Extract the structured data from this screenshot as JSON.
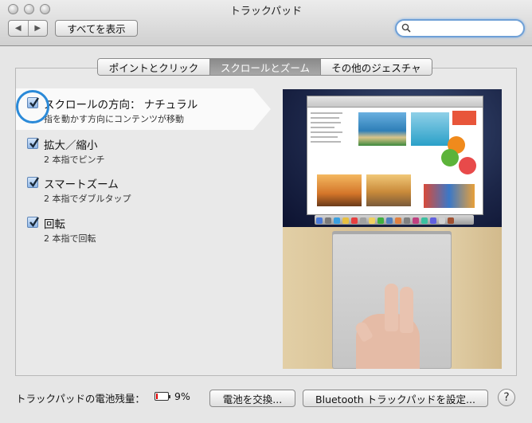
{
  "window": {
    "title": "トラックパッド"
  },
  "toolbar": {
    "show_all_label": "すべてを表示",
    "search_placeholder": ""
  },
  "tabs": [
    {
      "label": "ポイントとクリック",
      "selected": false
    },
    {
      "label": "スクロールとズーム",
      "selected": true
    },
    {
      "label": "その他のジェスチャ",
      "selected": false
    }
  ],
  "options": [
    {
      "title": "スクロールの方向： ナチュラル",
      "subtitle": "指を動かす方向にコンテンツが移動",
      "checked": true
    },
    {
      "title": "拡大／縮小",
      "subtitle": "2 本指でピンチ",
      "checked": true
    },
    {
      "title": "スマートズーム",
      "subtitle": "2 本指でダブルタップ",
      "checked": true
    },
    {
      "title": "回転",
      "subtitle": "2 本指で回転",
      "checked": true
    }
  ],
  "footer": {
    "battery_label": "トラックパッドの電池残量：",
    "battery_percent": "9%",
    "battery_level": 0.09,
    "replace_battery_label": "電池を交換...",
    "bluetooth_setup_label": "Bluetooth トラックパッドを設定...",
    "help_label": "?"
  },
  "colors": {
    "accent": "#2b8ad8",
    "battery_low": "#e00000"
  },
  "icons": [
    "close-icon",
    "minimize-icon",
    "zoom-icon",
    "back-arrow-icon",
    "forward-arrow-icon",
    "search-icon",
    "checkbox-checked-icon",
    "battery-icon",
    "help-icon"
  ]
}
